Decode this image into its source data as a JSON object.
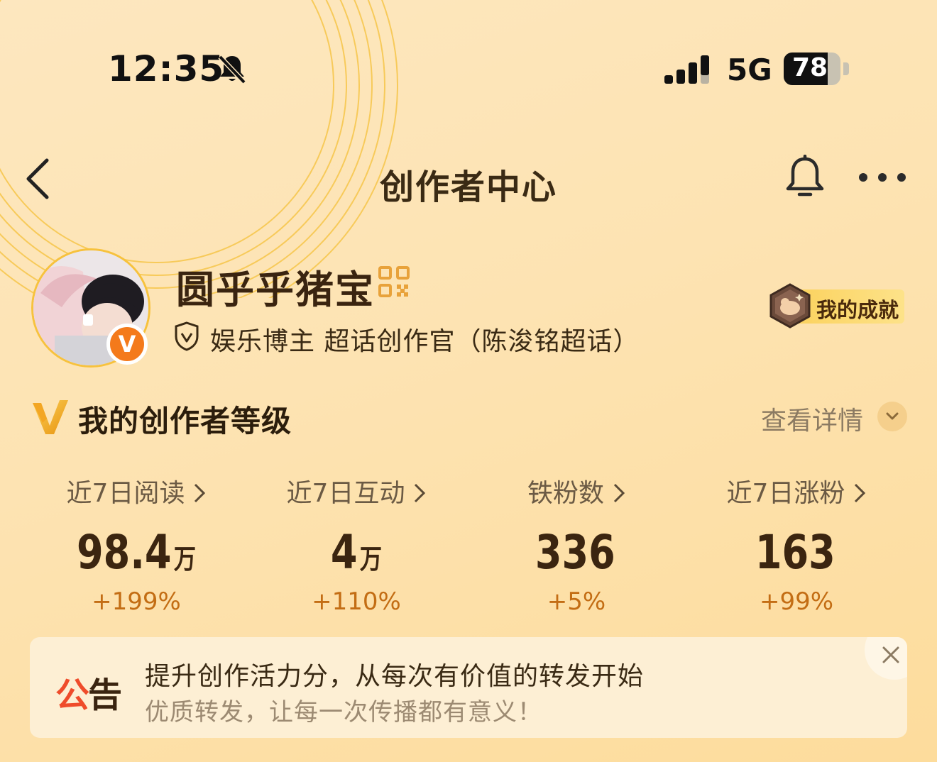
{
  "status_bar": {
    "time": "12:35",
    "network": "5G",
    "battery": "78",
    "battery_level": 0.78,
    "icons": [
      "bell-slash-icon",
      "signal-icon"
    ]
  },
  "nav": {
    "title": "创作者中心",
    "icons": [
      "back-icon",
      "bell-icon",
      "more-icon"
    ]
  },
  "profile": {
    "name": "圆乎乎猪宝",
    "verify_badge": "V",
    "verification": "娱乐博主 超话创作官（陈浚铭超话）",
    "achievement_label": "我的成就",
    "icons": [
      "qr-code-icon",
      "shield-check-icon",
      "achievement-badge-icon"
    ]
  },
  "level": {
    "title": "我的创作者等级",
    "details_link": "查看详情",
    "icons": [
      "v-level-icon",
      "chevron-down-icon"
    ]
  },
  "stats": [
    {
      "label": "近7日阅读",
      "value": "98.4",
      "unit": "万",
      "change": "+199%"
    },
    {
      "label": "近7日互动",
      "value": "4",
      "unit": "万",
      "change": "+110%"
    },
    {
      "label": "铁粉数",
      "value": "336",
      "unit": "",
      "change": "+5%"
    },
    {
      "label": "近7日涨粉",
      "value": "163",
      "unit": "",
      "change": "+99%"
    }
  ],
  "notice": {
    "tag_first": "公",
    "tag_second": "告",
    "line1": "提升创作活力分，从每次有价值的转发开始",
    "line2": "优质转发，让每一次传播都有意义！",
    "icons": [
      "close-icon"
    ]
  },
  "colors": {
    "background": "#fde3b2",
    "accent_orange": "#c36d14",
    "notice_red": "#ef4c2b",
    "badge_orange": "#f47a1b"
  }
}
